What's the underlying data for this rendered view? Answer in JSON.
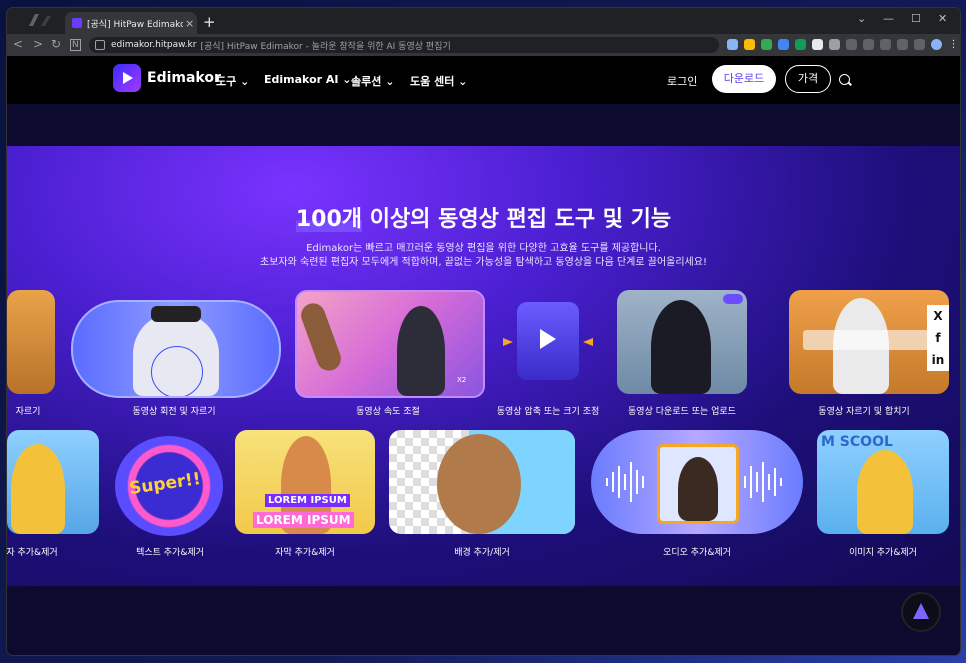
{
  "browser": {
    "tab_title": "[공식] HitPaw Edimakor - 놀",
    "new_tab": "+",
    "url_domain": "edimakor.hitpaw.kr",
    "url_title": "[공식] HitPaw Edimakor - 놀라운 창작을 위한 AI 동영상 편집기",
    "controls": {
      "minimize": "—",
      "maximize": "☐",
      "close": "✕",
      "dropdown": "⌄"
    },
    "nav_icons": {
      "back": "<",
      "forward": ">",
      "reload": "↻",
      "home": "N"
    },
    "colors": {
      "tab_bg": "#35363a",
      "bar_bg": "#202124"
    }
  },
  "site": {
    "brand": "Edimakor",
    "menu": [
      {
        "label": "도구 ⌄"
      },
      {
        "label": "Edimakor AI ⌄"
      },
      {
        "label": "솔루션 ⌄"
      },
      {
        "label": "도움 센터 ⌄"
      }
    ],
    "login": "로그인",
    "download": "다운로드",
    "price": "가격",
    "accent": "#5b3df5"
  },
  "hero": {
    "title_highlight": "100개",
    "title_rest": " 이상의 동영상 편집 도구 및 기능",
    "subtitle_1": "Edimakor는 빠르고 매끄러운 동영상 편집을 위한 다양한 고효율 도구를 제공합니다.",
    "subtitle_2": "초보자와 숙련된 편집자 모두에게 적합하며, 끝없는 가능성을 탐색하고 동영상을 다음 단계로 끌어올리세요!"
  },
  "row1": [
    {
      "label": "자르기"
    },
    {
      "label": "동영상 회전 및 자르기"
    },
    {
      "label": "동영상 속도 조절",
      "badge": "X2"
    },
    {
      "label": "동영상 압축 또는 크기 조정"
    },
    {
      "label": "동영상 다운로드 또는 업로드"
    },
    {
      "label": "동영상 자르기 및 합치기"
    }
  ],
  "row2": [
    {
      "label": "자 추가&제거"
    },
    {
      "label": "텍스트 추가&제거",
      "sticker": "Super!!"
    },
    {
      "label": "자막 추가&제거",
      "text1": "LOREM IPSUM",
      "text2": "LOREM IPSUM"
    },
    {
      "label": "배경 추가/제거"
    },
    {
      "label": "오디오 추가&제거"
    },
    {
      "label": "이미지 추가&제거",
      "bg_text": "M SCOOL"
    }
  ],
  "social": [
    "X",
    "f",
    "in"
  ]
}
